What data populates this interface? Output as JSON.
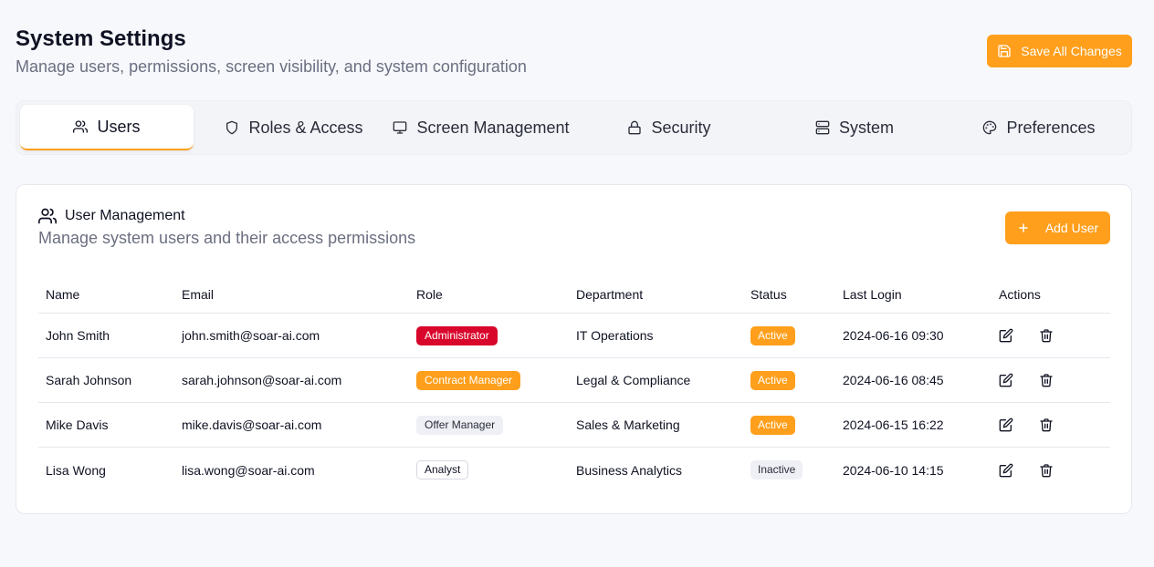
{
  "header": {
    "title": "System Settings",
    "subtitle": "Manage users, permissions, screen visibility, and system configuration",
    "save_label": "Save All Changes"
  },
  "tabs": [
    {
      "label": "Users",
      "icon": "users-icon",
      "active": true
    },
    {
      "label": "Roles & Access",
      "icon": "shield-icon"
    },
    {
      "label": "Screen Management",
      "icon": "monitor-icon"
    },
    {
      "label": "Security",
      "icon": "lock-icon"
    },
    {
      "label": "System",
      "icon": "server-icon"
    },
    {
      "label": "Preferences",
      "icon": "palette-icon"
    }
  ],
  "user_management": {
    "title": "User Management",
    "subtitle": "Manage system users and their access permissions",
    "add_label": "Add User",
    "columns": [
      "Name",
      "Email",
      "Role",
      "Department",
      "Status",
      "Last Login",
      "Actions"
    ],
    "rows": [
      {
        "name": "John Smith",
        "email": "john.smith@soar-ai.com",
        "role": "Administrator",
        "department": "IT Operations",
        "status": "Active",
        "last_login": "2024-06-16 09:30"
      },
      {
        "name": "Sarah Johnson",
        "email": "sarah.johnson@soar-ai.com",
        "role": "Contract Manager",
        "department": "Legal & Compliance",
        "status": "Active",
        "last_login": "2024-06-16 08:45"
      },
      {
        "name": "Mike Davis",
        "email": "mike.davis@soar-ai.com",
        "role": "Offer Manager",
        "department": "Sales & Marketing",
        "status": "Active",
        "last_login": "2024-06-15 16:22"
      },
      {
        "name": "Lisa Wong",
        "email": "lisa.wong@soar-ai.com",
        "role": "Analyst",
        "department": "Business Analytics",
        "status": "Inactive",
        "last_login": "2024-06-10 14:15"
      }
    ]
  },
  "colors": {
    "accent": "#ff9f1c",
    "danger": "#d9062b",
    "muted": "#6b6f80"
  }
}
